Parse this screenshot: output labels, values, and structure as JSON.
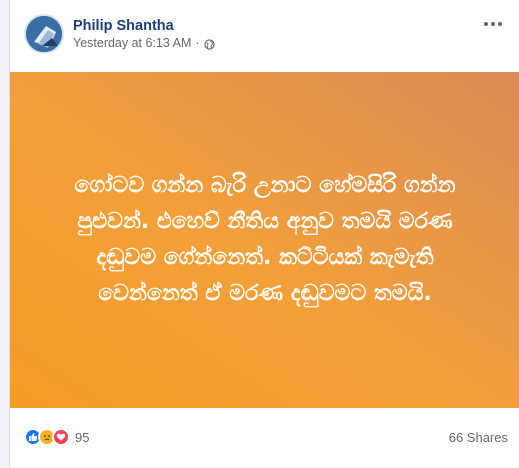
{
  "post": {
    "author": "Philip Shantha",
    "timestamp": "Yesterday at 6:13 AM",
    "separator": "·",
    "privacy_icon": "globe-icon",
    "body_lines": [
      "ගෝටව ගන්න බැරි උනාට හේමසිරි ගන්න",
      "පුළුවන්. එහෙව් නීතිය අනුව තමයි මරණ",
      "දඬුවම ගේන්නෙත්. කට්ටියක් කැමැති",
      "වෙන්නෙත් ඒ මරණ දඬුවමට තමයි."
    ],
    "background_colors": [
      "#f59b27",
      "#d98b55"
    ]
  },
  "footer": {
    "reaction_icons": [
      "like-icon",
      "sad-icon",
      "love-icon"
    ],
    "reaction_count": "95",
    "shares_text": "66 Shares"
  }
}
